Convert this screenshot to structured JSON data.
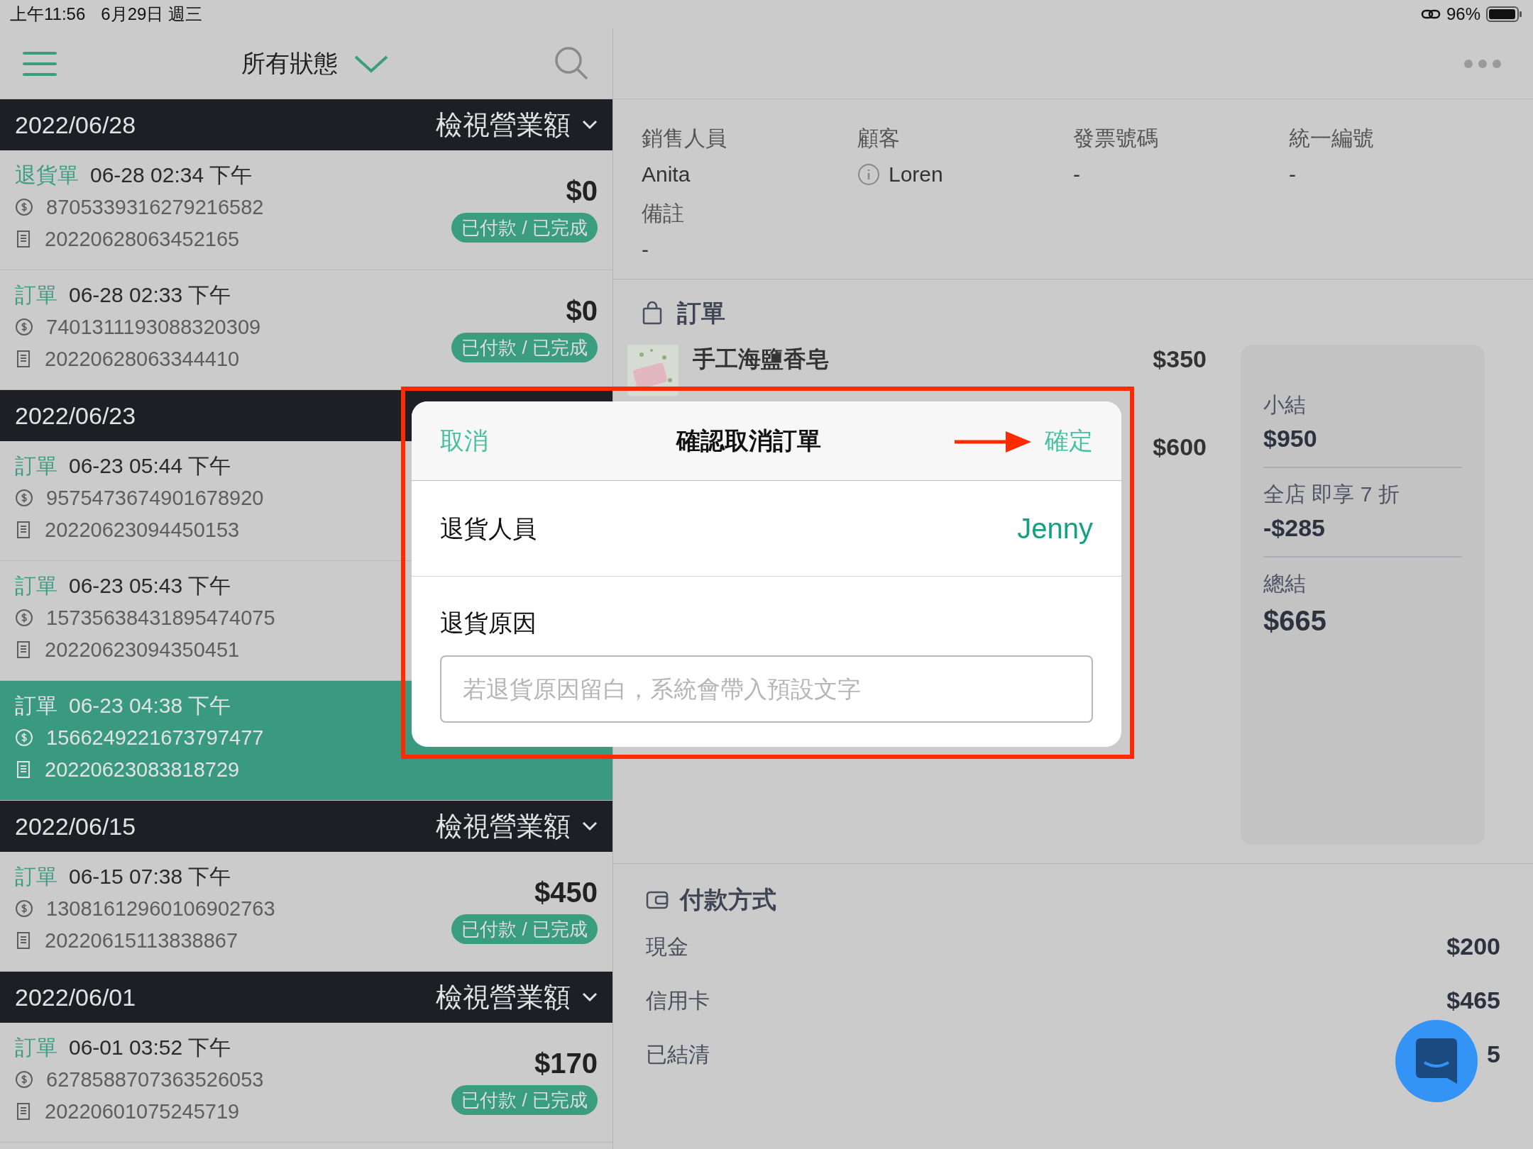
{
  "status_bar": {
    "time": "上午11:56",
    "date": "6月29日 週三",
    "battery": "96%"
  },
  "nav": {
    "filter_label": "所有狀態"
  },
  "groups": [
    {
      "date": "2022/06/28",
      "action": "檢視營業額",
      "orders": [
        {
          "type": "退貨單",
          "time": "06-28 02:34 下午",
          "payment_no": "8705339316279216582",
          "receipt_no": "20220628063452165",
          "amount": "$0",
          "status": "已付款 / 已完成",
          "selected": false
        },
        {
          "type": "訂單",
          "time": "06-28 02:33 下午",
          "payment_no": "7401311193088320309",
          "receipt_no": "20220628063344410",
          "amount": "$0",
          "status": "已付款 / 已完成",
          "selected": false
        }
      ]
    },
    {
      "date": "2022/06/23",
      "orders": [
        {
          "type": "訂單",
          "time": "06-23 05:44 下午",
          "payment_no": "9575473674901678920",
          "receipt_no": "20220623094450153",
          "selected": false
        },
        {
          "type": "訂單",
          "time": "06-23 05:43 下午",
          "payment_no": "15735638431895474075",
          "receipt_no": "20220623094350451",
          "selected": false
        },
        {
          "type": "訂單",
          "time": "06-23 04:38 下午",
          "payment_no": "1566249221673797477",
          "receipt_no": "20220623083818729",
          "selected": true
        }
      ]
    },
    {
      "date": "2022/06/15",
      "action": "檢視營業額",
      "orders": [
        {
          "type": "訂單",
          "time": "06-15 07:38 下午",
          "payment_no": "13081612960106902763",
          "receipt_no": "20220615113838867",
          "amount": "$450",
          "status": "已付款 / 已完成",
          "selected": false
        }
      ]
    },
    {
      "date": "2022/06/01",
      "action": "檢視營業額",
      "orders": [
        {
          "type": "訂單",
          "time": "06-01 03:52 下午",
          "payment_no": "6278588707363526053",
          "receipt_no": "20220601075245719",
          "amount": "$170",
          "status": "已付款 / 已完成",
          "selected": false
        }
      ]
    }
  ],
  "details": {
    "fields": [
      {
        "label": "銷售人員",
        "value": "Anita",
        "info": false
      },
      {
        "label": "顧客",
        "value": "Loren",
        "info": true
      },
      {
        "label": "發票號碼",
        "value": "-",
        "info": false
      },
      {
        "label": "統一編號",
        "value": "-",
        "info": false
      },
      {
        "label": "備註",
        "value": "-",
        "info": false
      }
    ]
  },
  "order": {
    "title": "訂單",
    "items": [
      {
        "name": "手工海鹽香皂",
        "price": "$350",
        "kind": "picture"
      },
      {
        "price": "$600"
      }
    ],
    "summary": [
      {
        "label": "小結",
        "value": "$950"
      },
      {
        "label": "全店 即享 7 折",
        "value": "-$285"
      },
      {
        "label": "總結",
        "value": "$665"
      }
    ]
  },
  "payment": {
    "title": "付款方式",
    "rows": [
      {
        "label": "現金",
        "value": "$200"
      },
      {
        "label": "信用卡",
        "value": "$465"
      },
      {
        "label": "已結清",
        "value": "5"
      }
    ]
  },
  "dialog": {
    "cancel": "取消",
    "title": "確認取消訂單",
    "confirm": "確定",
    "staff": {
      "label": "退貨人員",
      "value": "Jenny"
    },
    "reason": {
      "label": "退貨原因",
      "placeholder": "若退貨原因留白，系統會帶入預設文字"
    }
  }
}
